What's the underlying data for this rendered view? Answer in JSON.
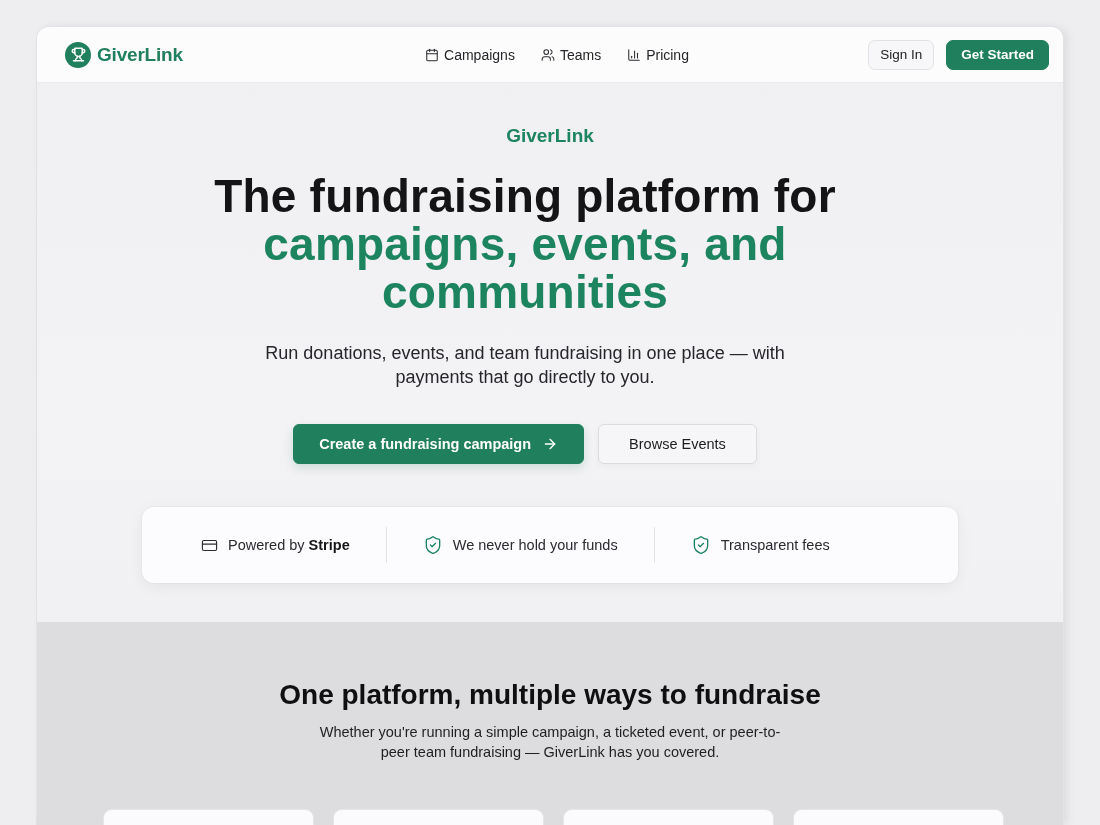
{
  "header": {
    "brand": "GiverLink",
    "nav": [
      {
        "label": "Campaigns"
      },
      {
        "label": "Teams"
      },
      {
        "label": "Pricing"
      }
    ],
    "buttons": [
      {
        "label": "Sign In",
        "kind": "secondary"
      },
      {
        "label": "Get Started",
        "kind": "primary"
      }
    ]
  },
  "hero": {
    "eyebrow": "GiverLink",
    "headline": {
      "lead": "The fundraising platform for",
      "accent": "campaigns, events, and communities"
    },
    "subtitle": "Run donations, events, and team fundraising in one place — with payments that go directly to you.",
    "buttons": [
      {
        "label": "Create a fundraising campaign",
        "kind": "primary"
      },
      {
        "label": "Browse Events",
        "kind": "secondary"
      }
    ],
    "trust": [
      {
        "text": "Powered by **Stripe**"
      },
      {
        "text": "We never hold your funds"
      },
      {
        "text": "Transparent fees"
      }
    ]
  },
  "features": {
    "title": "One platform, multiple ways to fundraise",
    "subtitle": "Whether you're running a simple campaign, a ticketed event, or peer-to-peer team fundraising — GiverLink has you covered.",
    "cards": [
      {
        "kind": "blank"
      },
      {
        "kind": "blank"
      },
      {
        "kind": "blank"
      },
      {
        "kind": "blank"
      }
    ]
  }
}
